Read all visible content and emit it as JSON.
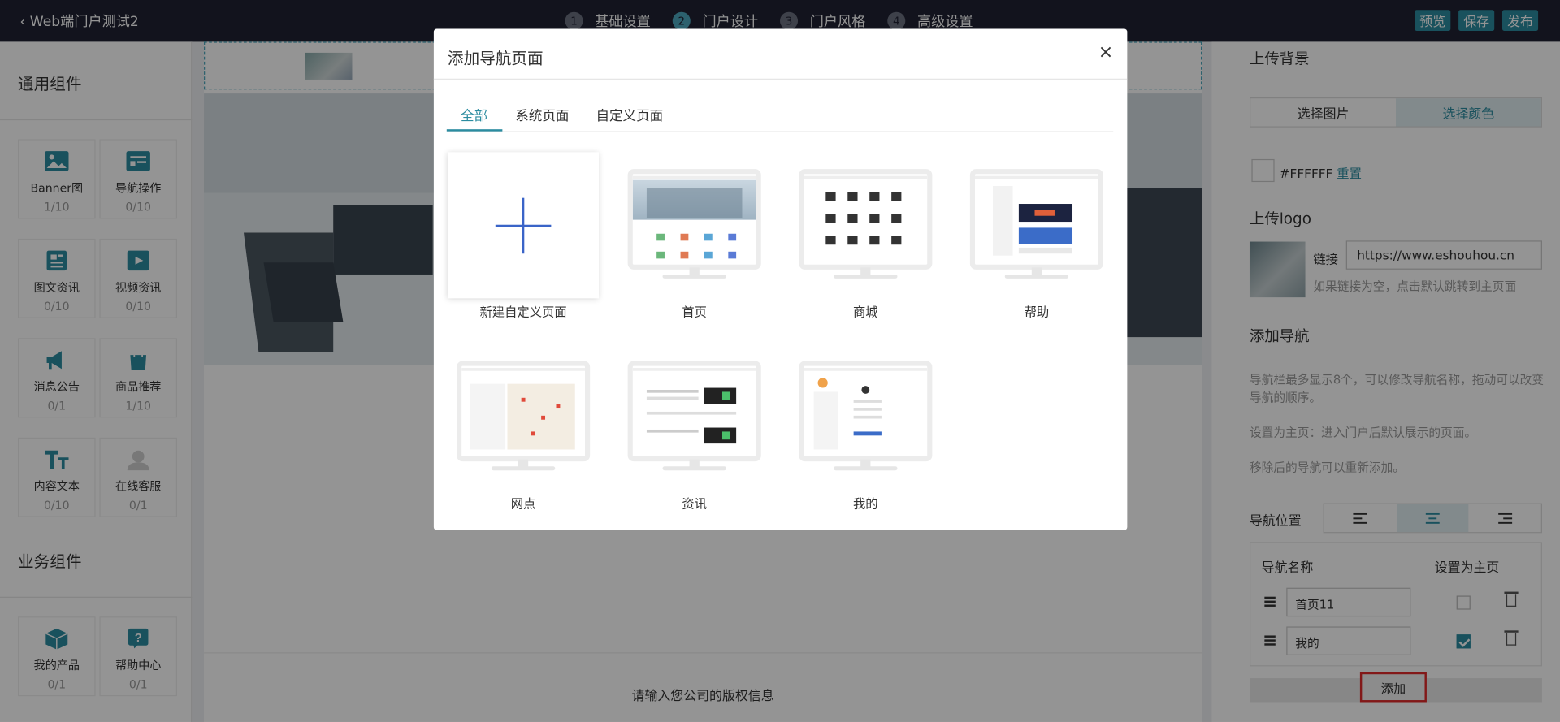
{
  "topbar": {
    "back_label": "Web端门户测试2",
    "steps": [
      {
        "num": "1",
        "label": "基础设置"
      },
      {
        "num": "2",
        "label": "门户设计"
      },
      {
        "num": "3",
        "label": "门户风格"
      },
      {
        "num": "4",
        "label": "高级设置"
      }
    ],
    "actions": [
      "预览",
      "保存",
      "发布"
    ]
  },
  "left_panel": {
    "general_title": "通用组件",
    "business_title": "业务组件",
    "components": [
      {
        "name": "Banner图",
        "count": "1/10",
        "icon": "image-icon"
      },
      {
        "name": "导航操作",
        "count": "0/10",
        "icon": "navigation-icon"
      },
      {
        "name": "图文资讯",
        "count": "0/10",
        "icon": "article-icon"
      },
      {
        "name": "视频资讯",
        "count": "0/10",
        "icon": "video-icon"
      },
      {
        "name": "消息公告",
        "count": "0/1",
        "icon": "megaphone-icon"
      },
      {
        "name": "商品推荐",
        "count": "1/10",
        "icon": "shopping-bag-icon"
      },
      {
        "name": "内容文本",
        "count": "0/10",
        "icon": "text-icon"
      },
      {
        "name": "在线客服",
        "count": "0/1",
        "icon": "customer-service-icon"
      }
    ],
    "business_components": [
      {
        "name": "我的产品",
        "count": "0/1",
        "icon": "cube-icon"
      },
      {
        "name": "帮助中心",
        "count": "0/1",
        "icon": "help-icon"
      }
    ]
  },
  "canvas": {
    "copyright_placeholder": "请输入您公司的版权信息"
  },
  "right_panel": {
    "upload_bg_title": "上传背景",
    "bg_options": [
      "选择图片",
      "选择颜色"
    ],
    "color_value": "#FFFFFF",
    "reset_label": "重置",
    "upload_logo_title": "上传logo",
    "link_label": "链接",
    "link_value": "https://www.eshouhou.cn",
    "link_hint": "如果链接为空，点击默认跳转到主页面",
    "add_nav_title": "添加导航",
    "help_1": "导航栏最多显示8个，可以修改导航名称，拖动可以改变导航的顺序。",
    "help_2": "设置为主页：进入门户后默认展示的页面。",
    "help_3": "移除后的导航可以重新添加。",
    "nav_position_label": "导航位置",
    "nav_table_header_name": "导航名称",
    "nav_table_header_home": "设置为主页",
    "nav_items": [
      {
        "name": "首页11",
        "is_home": false
      },
      {
        "name": "我的",
        "is_home": true
      }
    ],
    "add_button": "添加",
    "colors": {
      "accent": "#2b8ca0",
      "highlight_border": "#e02a2a"
    }
  },
  "modal": {
    "title": "添加导航页面",
    "close": "×",
    "tabs": [
      "全部",
      "系统页面",
      "自定义页面"
    ],
    "active_tab": "全部",
    "pages": [
      {
        "label": "新建自定义页面",
        "type": "new"
      },
      {
        "label": "首页",
        "type": "preview"
      },
      {
        "label": "商城",
        "type": "preview"
      },
      {
        "label": "帮助",
        "type": "preview"
      },
      {
        "label": "网点",
        "type": "preview"
      },
      {
        "label": "资讯",
        "type": "preview"
      },
      {
        "label": "我的",
        "type": "preview"
      }
    ]
  }
}
